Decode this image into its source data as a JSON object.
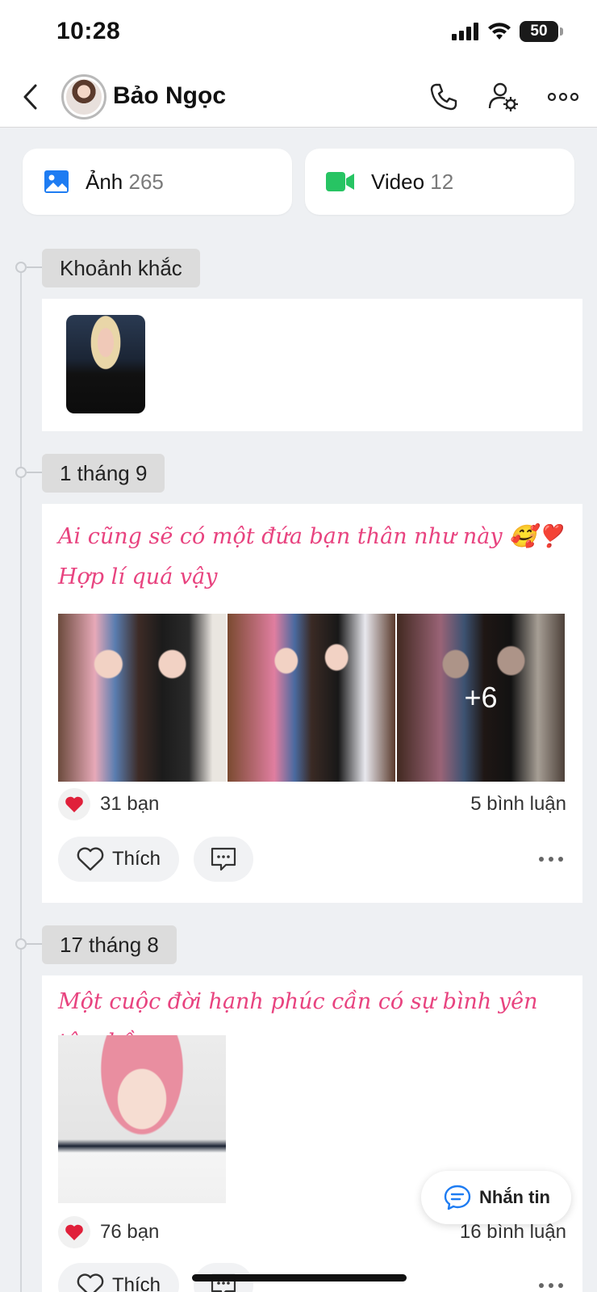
{
  "status_bar": {
    "time": "10:28",
    "battery": "50"
  },
  "header": {
    "contact_name": "Bảo Ngọc"
  },
  "media": {
    "photos": {
      "label": "Ảnh",
      "count": "265"
    },
    "videos": {
      "label": "Video",
      "count": "12"
    }
  },
  "sections": [
    {
      "date": "Khoảnh khắc"
    },
    {
      "date": "1 tháng 9",
      "caption_line1": "Ai cũng sẽ có một đứa bạn thân như này 🥰❣️",
      "caption_line2": "Hợp lí quá vậy",
      "more_photos": "+6",
      "reactions": "31 bạn",
      "comments": "5 bình luận",
      "like_label": "Thích"
    },
    {
      "date": "17 tháng 8",
      "caption": "Một cuộc đời hạnh phúc cần có sự bình yên tâm hồn.",
      "reactions": "76 bạn",
      "comments": "16 bình luận",
      "like_label": "Thích"
    }
  ],
  "fab": {
    "label": "Nhắn tin"
  },
  "colors": {
    "accent_pink": "#e8437f",
    "link_blue": "#1e7cf2",
    "video_green": "#27c463",
    "heart_red": "#e0203a"
  }
}
